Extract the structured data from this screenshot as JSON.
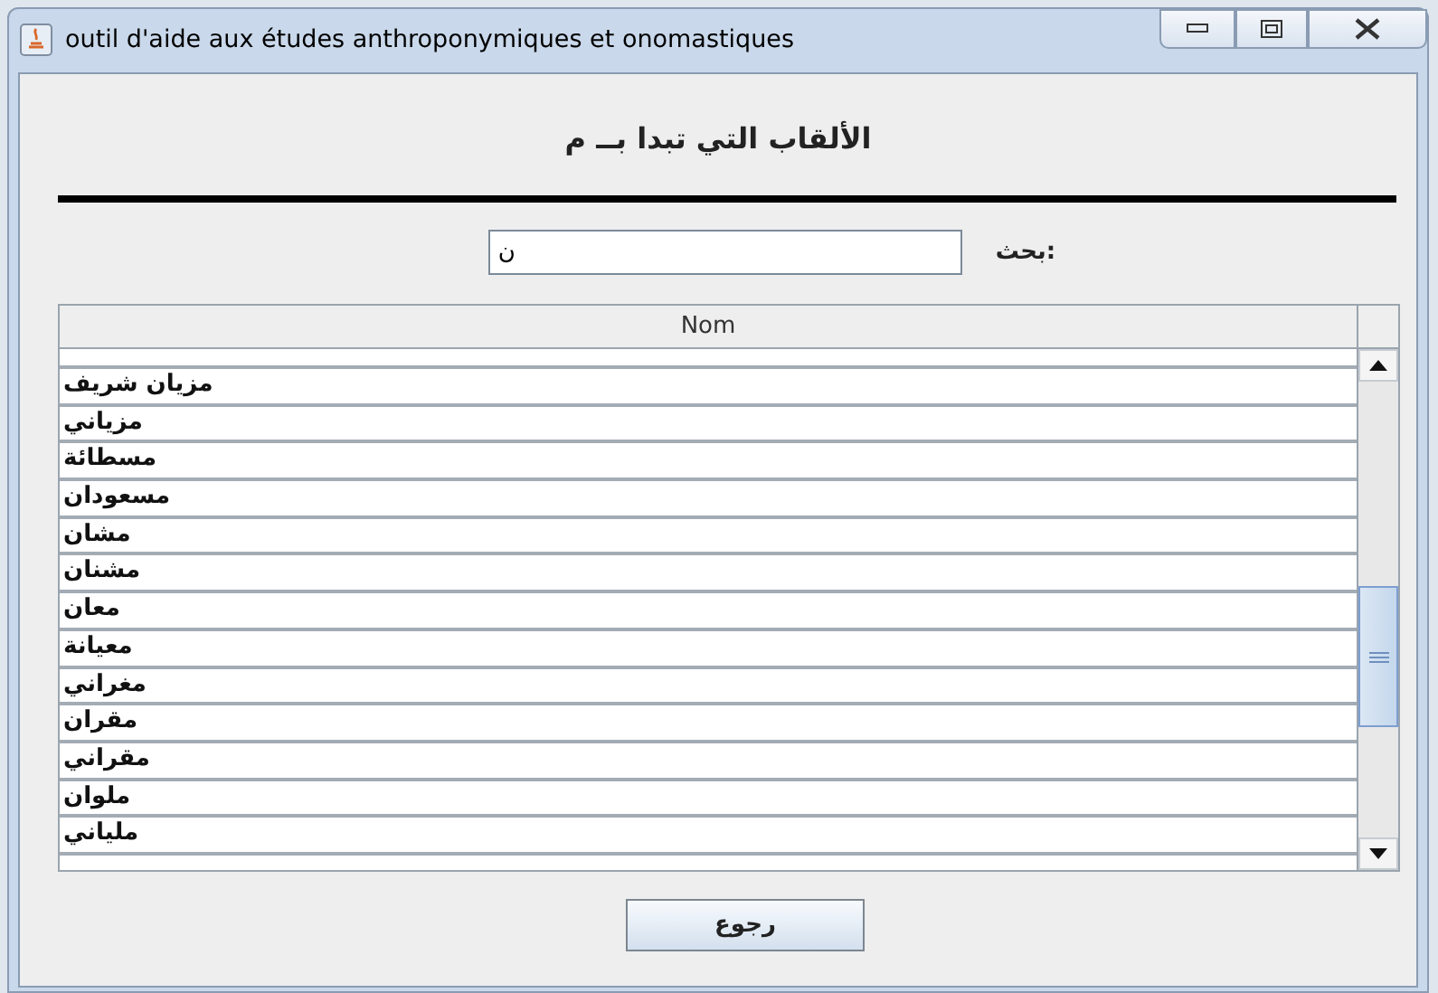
{
  "window": {
    "title": "outil d'aide aux études anthroponymiques et onomastiques"
  },
  "heading": "الألقاب التي تبدا بــ م",
  "search": {
    "label": "بحث:",
    "value": "ن"
  },
  "table": {
    "columns": [
      "Nom"
    ],
    "rows": [
      "مزيان شريف",
      "مزياني",
      "مسطائة",
      "مسعودان",
      "مشان",
      "مشنان",
      "معان",
      "معيانة",
      "مغراني",
      "مقران",
      "مقراني",
      "ملوان",
      "ملياني"
    ]
  },
  "buttons": [
    "رجوع"
  ]
}
